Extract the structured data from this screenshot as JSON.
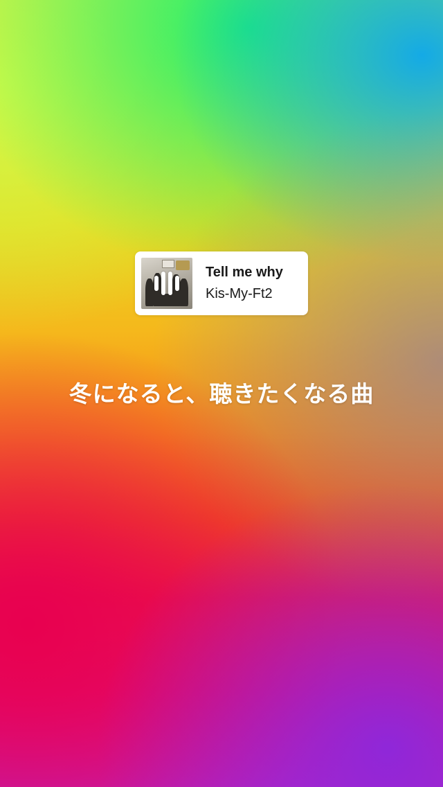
{
  "music_sticker": {
    "title": "Tell me why",
    "artist": "Kis-My-Ft2",
    "album_art_icon": "album-cover-image",
    "playing_indicator_icon": "sound-wave-icon"
  },
  "caption": {
    "text": "冬になると、聴きたくなる曲"
  },
  "colors": {
    "card_background": "#ffffff",
    "text_dark": "#1a1a1a",
    "caption_text": "#ffffff"
  }
}
